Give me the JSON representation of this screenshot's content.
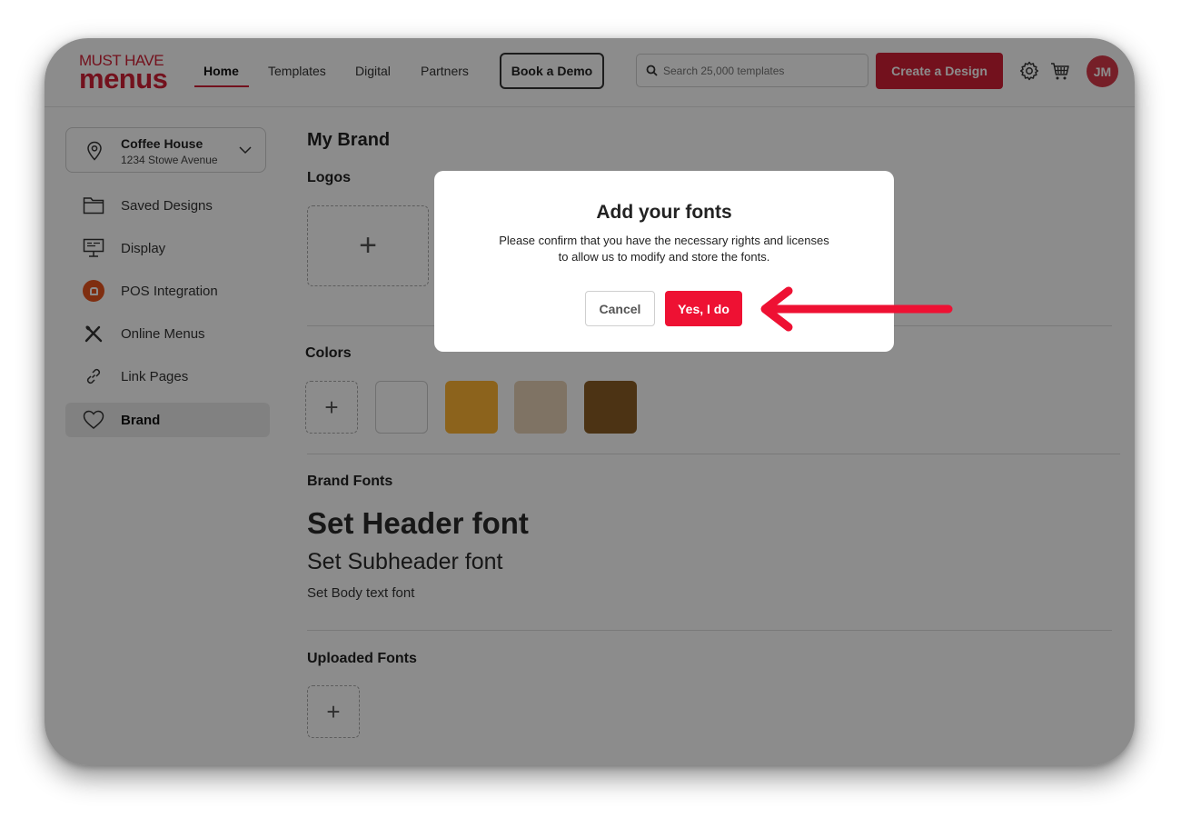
{
  "header": {
    "logo": {
      "line1": "MUST HAVE",
      "line2": "menus"
    },
    "nav": [
      "Home",
      "Templates",
      "Digital",
      "Partners"
    ],
    "book_demo_label": "Book a Demo",
    "search_placeholder": "Search 25,000 templates",
    "create_label": "Create a Design",
    "avatar_initials": "JM",
    "icons": [
      "search-icon",
      "gear-icon",
      "cart-icon"
    ]
  },
  "sidebar": {
    "location": {
      "name": "Coffee House",
      "address": "1234 Stowe Avenue"
    },
    "items": [
      {
        "label": "Saved Designs",
        "icon": "folder-icon"
      },
      {
        "label": "Display",
        "icon": "monitor-icon"
      },
      {
        "label": "POS Integration",
        "icon": "pos-icon"
      },
      {
        "label": "Online Menus",
        "icon": "utensils-icon"
      },
      {
        "label": "Link Pages",
        "icon": "link-icon"
      },
      {
        "label": "Brand",
        "icon": "heart-icon",
        "active": true
      }
    ]
  },
  "main": {
    "title": "My Brand",
    "logos_title": "Logos",
    "colors_title": "Colors",
    "colors": [
      "#ffffff",
      "#ffb534",
      "#e8d1b6",
      "#8a5e25"
    ],
    "brand_fonts_title": "Brand Fonts",
    "header_font": "Set Header font",
    "subheader_font": "Set Subheader font",
    "body_font": "Set Body text font",
    "uploaded_fonts_title": "Uploaded Fonts",
    "add_symbol": "+"
  },
  "modal": {
    "title": "Add your fonts",
    "text": "Please confirm that you have the necessary rights and licenses to allow us to modify and store the fonts.",
    "cancel_label": "Cancel",
    "confirm_label": "Yes, I do"
  },
  "annotation": {
    "arrow_color": "#ee1133"
  }
}
